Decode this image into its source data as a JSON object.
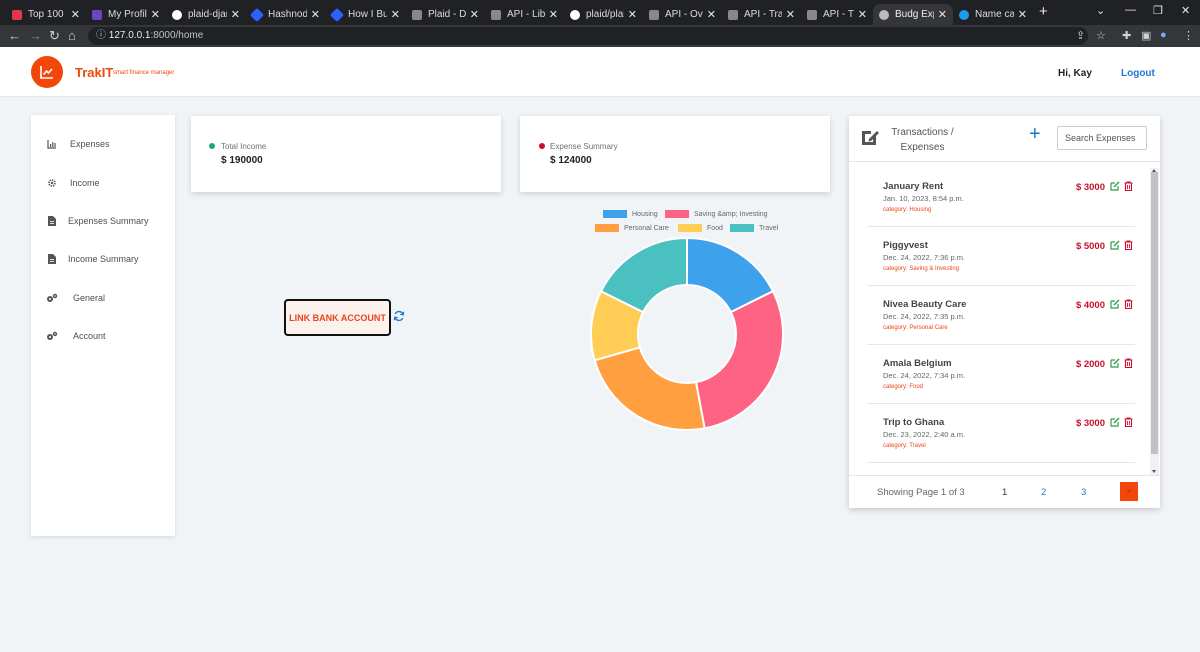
{
  "browser": {
    "tabs": [
      {
        "title": "Top 100 Py",
        "color": "#e2384d"
      },
      {
        "title": "My Profile",
        "color": "#6b46c1"
      },
      {
        "title": "plaid-djang",
        "color": "#ffffff"
      },
      {
        "title": "Hashnode",
        "color": "#2962ff"
      },
      {
        "title": "How I Built",
        "color": "#2962ff"
      },
      {
        "title": "Plaid - Dash",
        "color": "#888888"
      },
      {
        "title": "API - Librar",
        "color": "#888888"
      },
      {
        "title": "plaid/plaid",
        "color": "#ffffff"
      },
      {
        "title": "API - Overv",
        "color": "#888888"
      },
      {
        "title": "API - Transa",
        "color": "#888888"
      },
      {
        "title": "API - Transa",
        "color": "#888888"
      },
      {
        "title": "Budg Expen",
        "color": "#bbbbbb"
      },
      {
        "title": "Name cann",
        "color": "#1d9bf0"
      }
    ],
    "url_host": "127.0.0.1",
    "url_path": ":8000/home"
  },
  "app": {
    "brand": "TrakIT",
    "tagline": "smart finance manager",
    "greeting": "Hi, Kay",
    "logout": "Logout",
    "accent": "#f2470b"
  },
  "sidebar": {
    "items": [
      {
        "label": "Expenses",
        "icon": "chart-icon"
      },
      {
        "label": "Income",
        "icon": "gear-icon"
      },
      {
        "label": "Expenses Summary",
        "icon": "file-icon"
      },
      {
        "label": "Income Summary",
        "icon": "file-icon"
      },
      {
        "label": "General",
        "icon": "settings-icon"
      },
      {
        "label": "Account",
        "icon": "settings-icon"
      }
    ]
  },
  "cards": {
    "income": {
      "label": "Total Income",
      "value": "$ 190000",
      "dot_color": "#1aab6b"
    },
    "expense": {
      "label": "Expense Summary",
      "value": "$ 124000",
      "dot_color": "#c8102e"
    }
  },
  "link_bank": "LINK BANK ACCOUNT",
  "chart_data": {
    "type": "pie",
    "categories": [
      "Housing",
      "Saving &amp; Investing",
      "Personal Care",
      "Food",
      "Travel"
    ],
    "values": [
      3000,
      5000,
      4000,
      2000,
      3000
    ],
    "colors": [
      "#3ea1ec",
      "#ff6384",
      "#ff9f40",
      "#ffcd56",
      "#4bc0c0"
    ],
    "legend_position": "top"
  },
  "transactions": {
    "title": "Transactions / Expenses",
    "search_placeholder": "Search Expenses",
    "items": [
      {
        "name": "January Rent",
        "date": "Jan. 10, 2023, 8:54 p.m.",
        "category": "category: Housing",
        "amount": "$ 3000"
      },
      {
        "name": "Piggyvest",
        "date": "Dec. 24, 2022, 7:36 p.m.",
        "category": "category: Saving & Investing",
        "amount": "$ 5000"
      },
      {
        "name": "Nivea Beauty Care",
        "date": "Dec. 24, 2022, 7:35 p.m.",
        "category": "category: Personal Care",
        "amount": "$ 4000"
      },
      {
        "name": "Amala Belgium",
        "date": "Dec. 24, 2022, 7:34 p.m.",
        "category": "category: Food",
        "amount": "$ 2000"
      },
      {
        "name": "Trip to Ghana",
        "date": "Dec. 23, 2022, 2:40 a.m.",
        "category": "category: Travel",
        "amount": "$ 3000"
      }
    ],
    "pagination": {
      "info": "Showing Page 1 of 3",
      "pages": [
        "1",
        "2",
        "3"
      ],
      "next": "»"
    }
  }
}
